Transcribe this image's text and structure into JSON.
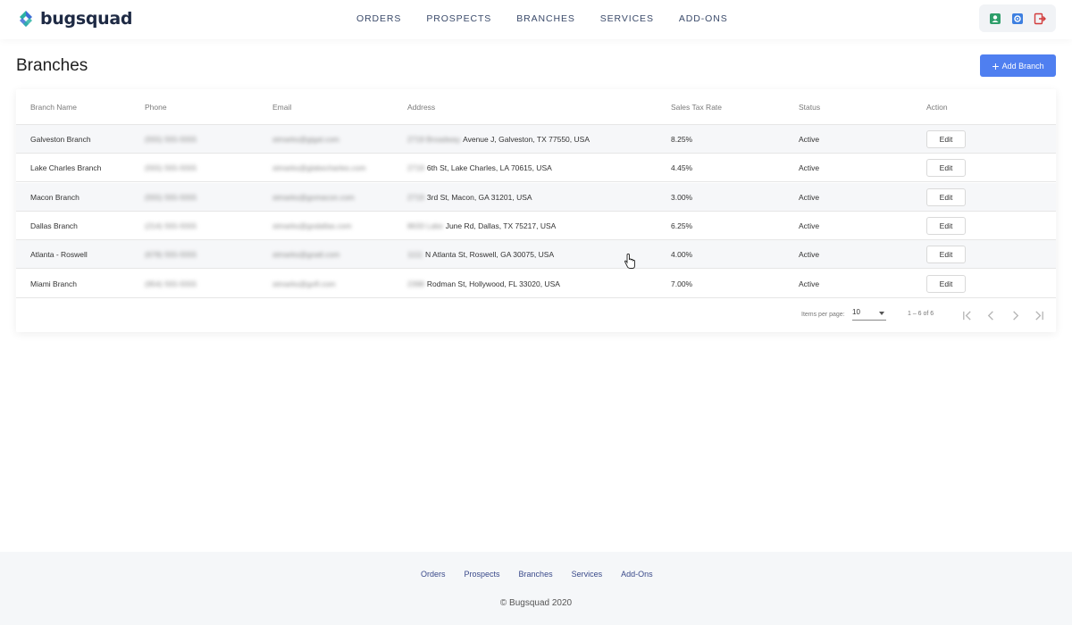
{
  "app": {
    "brand": "bugsquad",
    "colors": {
      "accent": "#4f7ff0",
      "logo_teal": "#2bb3a3",
      "logo_blue": "#3d6fd6"
    }
  },
  "nav": {
    "items": [
      "ORDERS",
      "PROSPECTS",
      "BRANCHES",
      "SERVICES",
      "ADD-ONS"
    ]
  },
  "header_icons": [
    "user-icon",
    "gear-icon",
    "logout-icon"
  ],
  "page": {
    "title": "Branches",
    "add_button": "Add Branch"
  },
  "table": {
    "columns": [
      "Branch Name",
      "Phone",
      "Email",
      "Address",
      "Sales Tax Rate",
      "Status",
      "Action"
    ],
    "rows": [
      {
        "name": "Galveston Branch",
        "phone": "(555) 555-5555",
        "email": "stmarks@gigal.com",
        "address_hidden": "2719 Broadway",
        "address": "Avenue J, Galveston, TX 77550, USA",
        "tax": "8.25%",
        "status": "Active",
        "action": "Edit"
      },
      {
        "name": "Lake Charles Branch",
        "phone": "(555) 555-5555",
        "email": "stmarks@glakecharles.com",
        "address_hidden": "2719",
        "address": "6th St, Lake Charles, LA 70615, USA",
        "tax": "4.45%",
        "status": "Active",
        "action": "Edit"
      },
      {
        "name": "Macon Branch",
        "phone": "(555) 555-5555",
        "email": "stmarks@gomacon.com",
        "address_hidden": "2719",
        "address": "3rd St, Macon, GA 31201, USA",
        "tax": "3.00%",
        "status": "Active",
        "action": "Edit"
      },
      {
        "name": "Dallas Branch",
        "phone": "(214) 555-5555",
        "email": "stmarks@godallas.com",
        "address_hidden": "8633 Lake",
        "address": "June Rd, Dallas, TX 75217, USA",
        "tax": "6.25%",
        "status": "Active",
        "action": "Edit"
      },
      {
        "name": "Atlanta - Roswell",
        "phone": "(678) 555-5555",
        "email": "stmarks@goatl.com",
        "address_hidden": "1111",
        "address": "N Atlanta St, Roswell, GA 30075, USA",
        "tax": "4.00%",
        "status": "Active",
        "action": "Edit"
      },
      {
        "name": "Miami Branch",
        "phone": "(954) 555-5555",
        "email": "stmarks@gofl.com",
        "address_hidden": "2398",
        "address": "Rodman St, Hollywood, FL 33020, USA",
        "tax": "7.00%",
        "status": "Active",
        "action": "Edit"
      }
    ]
  },
  "pagination": {
    "items_per_page_label": "Items per page:",
    "items_per_page": "10",
    "range": "1 – 6 of 6"
  },
  "footer": {
    "links": [
      "Orders",
      "Prospects",
      "Branches",
      "Services",
      "Add-Ons"
    ],
    "copyright": "© Bugsquad 2020"
  }
}
